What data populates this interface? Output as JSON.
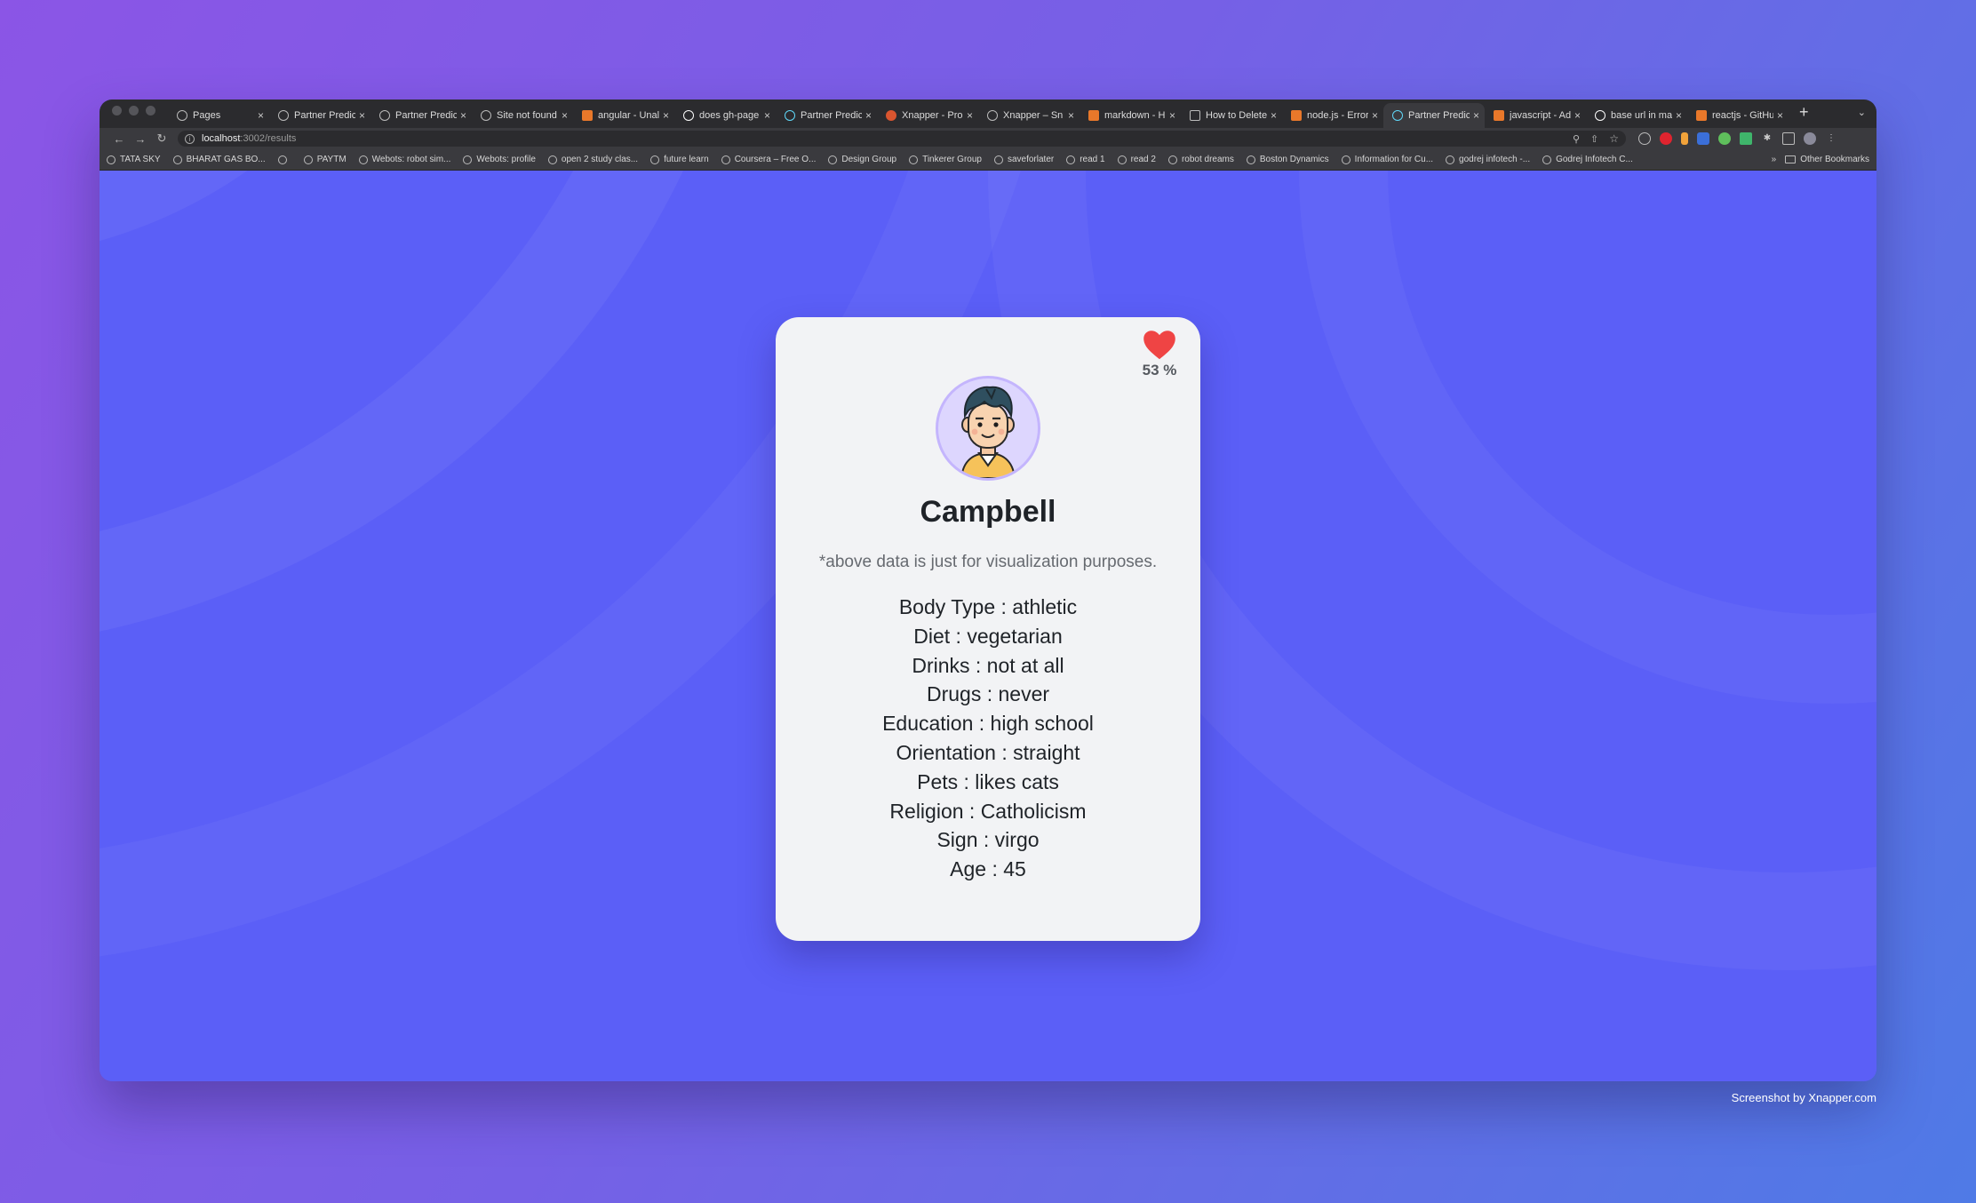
{
  "browser": {
    "tabs": [
      {
        "label": "Pages",
        "icon": "github-icon"
      },
      {
        "label": "Partner Predic",
        "icon": "globe-icon"
      },
      {
        "label": "Partner Predic",
        "icon": "globe-icon"
      },
      {
        "label": "Site not found",
        "icon": "globe-icon"
      },
      {
        "label": "angular - Unal",
        "icon": "stackoverflow-icon"
      },
      {
        "label": "does gh-page",
        "icon": "google-icon"
      },
      {
        "label": "Partner Predic",
        "icon": "react-icon"
      },
      {
        "label": "Xnapper - Pro",
        "icon": "producthunt-icon"
      },
      {
        "label": "Xnapper – Sn",
        "icon": "globe-icon"
      },
      {
        "label": "markdown - H",
        "icon": "stackoverflow-icon"
      },
      {
        "label": "How to Delete",
        "icon": "ai-icon"
      },
      {
        "label": "node.js - Error",
        "icon": "stackoverflow-icon"
      },
      {
        "label": "Partner Predic",
        "icon": "react-icon"
      },
      {
        "label": "javascript - Ad",
        "icon": "stackoverflow-icon"
      },
      {
        "label": "base url in ma",
        "icon": "google-icon"
      },
      {
        "label": "reactjs - GitHu",
        "icon": "stackoverflow-icon"
      }
    ],
    "active_tab_index": 12,
    "url_host": "localhost",
    "url_path": ":3002/results",
    "bookmarks": [
      "TATA SKY",
      "BHARAT GAS BO...",
      "",
      "PAYTM",
      "Webots: robot sim...",
      "Webots: profile",
      "open 2 study clas...",
      "future learn",
      "Coursera – Free O...",
      "Design Group",
      "Tinkerer Group",
      "saveforlater",
      "read 1",
      "read 2",
      "robot dreams",
      "Boston Dynamics",
      "Information for Cu...",
      "godrej infotech -...",
      "Godrej Infotech C..."
    ],
    "bookmarks_more": "»",
    "other_bookmarks": "Other Bookmarks"
  },
  "profile": {
    "match_percent": "53 %",
    "match_value": 0.53,
    "name": "Campbell",
    "disclaimer": "*above data is just for visualization purposes.",
    "attributes": [
      "Body Type : athletic",
      "Diet : vegetarian",
      "Drinks : not at all",
      "Drugs : never",
      "Education : high school",
      "Orientation : straight",
      "Pets : likes cats",
      "Religion : Catholicism",
      "Sign : virgo",
      "Age : 45"
    ]
  },
  "credit": "Screenshot by Xnapper.com",
  "colors": {
    "page_bg": "#5b5ff7",
    "card_bg": "#f2f3f5",
    "heart": "#ef4444",
    "avatar_bg": "#ddd6fe"
  }
}
